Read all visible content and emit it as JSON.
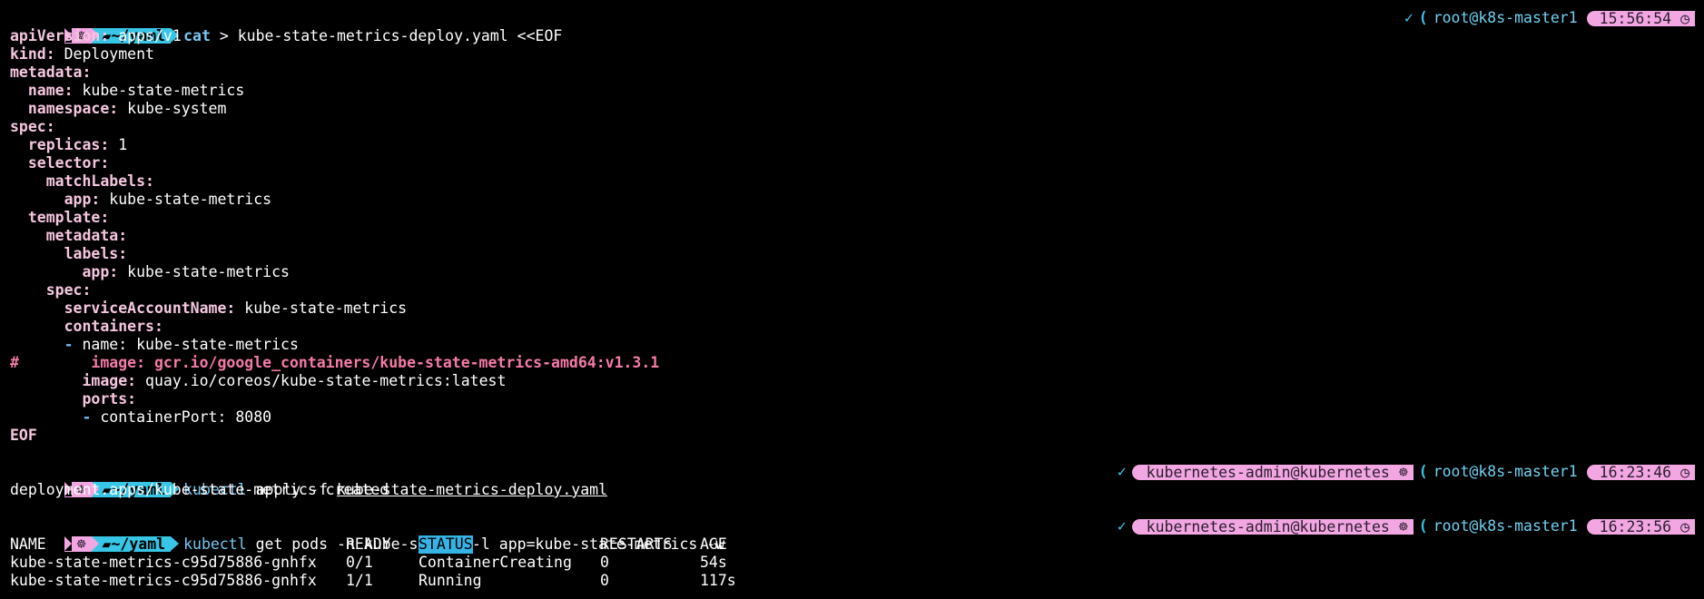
{
  "prompt": {
    "os_icon": "☸",
    "folder_icon": "folder-icon",
    "dir": "~/yaml",
    "user_host": "root@k8s-master1",
    "check": "✓",
    "paren": "(",
    "context": "kubernetes-admin@kubernetes",
    "ctx_icon": "☸",
    "clock_icon": "◷"
  },
  "cmd1": {
    "name": "cat",
    "rest": " > kube-state-metrics-deploy.yaml <<EOF",
    "time": "15:56:54"
  },
  "yaml": {
    "l1k": "apiVersion:",
    "l1v": " apps/v1",
    "l2k": "kind:",
    "l2v": " Deployment",
    "l3k": "metadata:",
    "l4k": "name:",
    "l4v": " kube-state-metrics",
    "l5k": "namespace:",
    "l5v": " kube-system",
    "l6k": "spec:",
    "l7k": "replicas:",
    "l7v": " 1",
    "l8k": "selector:",
    "l9k": "matchLabels:",
    "l10k": "app:",
    "l10v": " kube-state-metrics",
    "l11k": "template:",
    "l12k": "metadata:",
    "l13k": "labels:",
    "l14k": "app:",
    "l14v": " kube-state-metrics",
    "l15k": "spec:",
    "l16k": "serviceAccountName:",
    "l16v": " kube-state-metrics",
    "l17k": "containers:",
    "l18d": "-",
    "l18v": " name: kube-state-metrics",
    "l19": "#        image: gcr.io/google_containers/kube-state-metrics-amd64:v1.3.1",
    "l20k": "image:",
    "l20v": " quay.io/coreos/kube-state-metrics:latest",
    "l21k": "ports:",
    "l22d": "-",
    "l22v": " containerPort: 8080",
    "l23": "EOF"
  },
  "cmd2": {
    "name": "kubectl",
    "pre": " apply -f ",
    "file": "kube-state-metrics-deploy.yaml",
    "time": "16:23:46",
    "output": "deployment.apps/kube-state-metrics created"
  },
  "cmd3": {
    "name": "kubectl",
    "rest": " get pods -n kube-system -l app=kube-state-metrics -w",
    "time": "16:23:56"
  },
  "table": {
    "headers": [
      "NAME",
      "READY",
      "STATUS",
      "RESTARTS",
      "AGE"
    ],
    "rows": [
      [
        "kube-state-metrics-c95d75886-gnhfx",
        "0/1",
        "ContainerCreating",
        "0",
        "54s"
      ],
      [
        "kube-state-metrics-c95d75886-gnhfx",
        "1/1",
        "Running",
        "0",
        "117s"
      ]
    ]
  }
}
